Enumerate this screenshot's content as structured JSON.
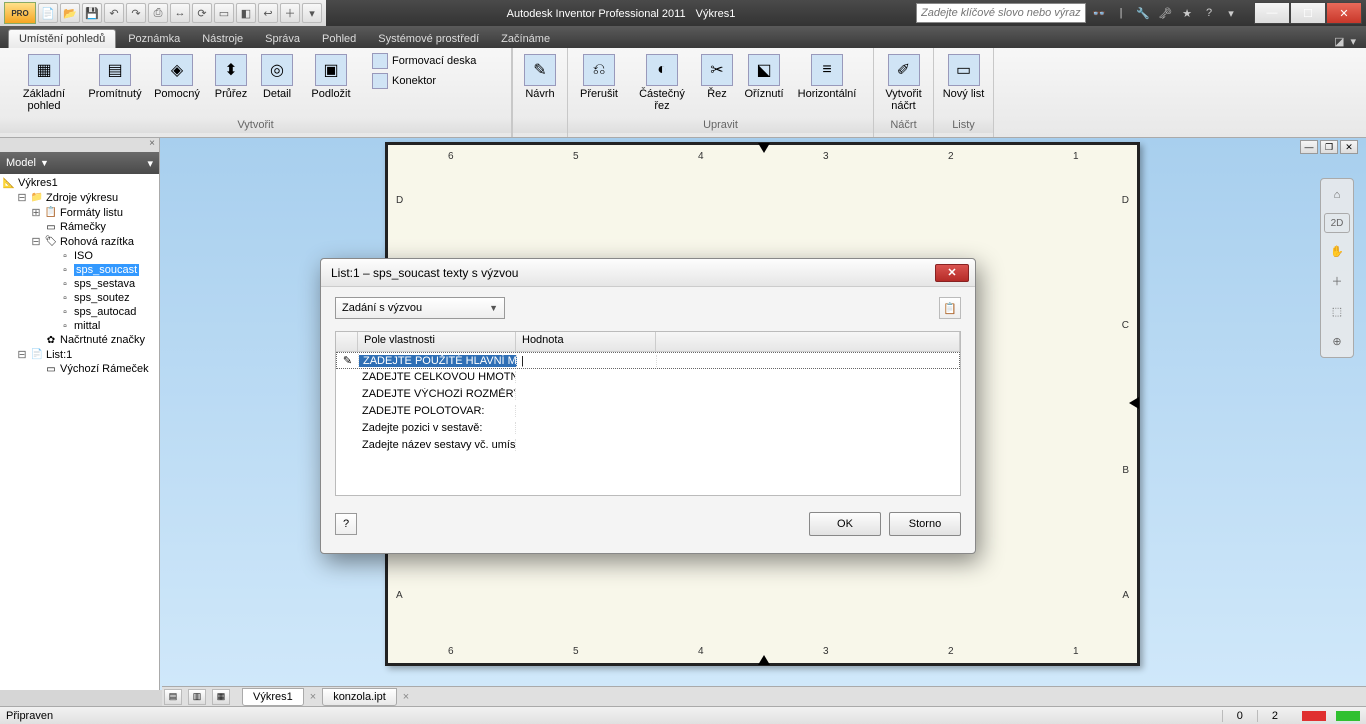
{
  "title_bar": {
    "app_name": "Autodesk Inventor Professional 2011",
    "doc_name": "Výkres1",
    "logo": "PRO",
    "search_placeholder": "Zadejte klíčové slovo nebo výraz."
  },
  "ribbon_tabs": {
    "items": [
      "Umístění pohledů",
      "Poznámka",
      "Nástroje",
      "Správa",
      "Pohled",
      "Systémové prostředí",
      "Začínáme"
    ],
    "active": 0
  },
  "ribbon": {
    "group_create": {
      "label": "Vytvořit",
      "zakladni": "Základní pohled",
      "promitnutý": "Promítnutý",
      "pomocny": "Pomocný",
      "prurez": "Průřez",
      "detail": "Detail",
      "podlozit": "Podložit",
      "formovaci": "Formovací deska",
      "konektor": "Konektor"
    },
    "group_navrh": {
      "navrh": "Návrh"
    },
    "group_upravit": {
      "label": "Upravit",
      "prerusit": "Přerušit",
      "castecny": "Částečný řez",
      "rez": "Řez",
      "oriznuti": "Oříznutí",
      "horizontalni": "Horizontální"
    },
    "group_nacrt": {
      "label": "Náčrt",
      "vytvorit": "Vytvořit náčrt"
    },
    "group_listy": {
      "label": "Listy",
      "novy": "Nový list"
    }
  },
  "browser": {
    "header": "Model",
    "root": "Výkres1",
    "zdroje": "Zdroje výkresu",
    "formaty": "Formáty listu",
    "ramecky": "Rámečky",
    "rohova": "Rohová razítka",
    "iso": "ISO",
    "sps_soucast": "sps_soucast",
    "sps_sestava": "sps_sestava",
    "sps_soutez": "sps_soutez",
    "sps_autocad": "sps_autocad",
    "mittal": "mittal",
    "nacrtnute": "Načrtnuté značky",
    "list1": "List:1",
    "vychozi": "Výchozí Rámeček"
  },
  "dialog": {
    "title": "List:1 – sps_soucast texty s výzvou",
    "combo": "Zadání s výzvou",
    "col_pole": "Pole vlastnosti",
    "col_hodnota": "Hodnota",
    "rows": [
      "ZADEJTE POUŽITÉ HLAVNÍ MĚŘ",
      "ZADEJTE CELKOVOU HMOTNOS",
      "ZADEJTE VÝCHOZÍ ROZMĚRY:",
      "ZADEJTE POLOTOVAR:",
      "Zadejte pozici v sestavě:",
      "Zadejte název sestavy vč. umís"
    ],
    "ok": "OK",
    "storno": "Storno"
  },
  "bottom_tabs": {
    "tab1": "Výkres1",
    "tab2": "konzola.ipt"
  },
  "status": {
    "ready": "Připraven",
    "num1": "0",
    "num2": "2"
  },
  "ruler": {
    "n1": "1",
    "n2": "2",
    "n3": "3",
    "n4": "4",
    "n5": "5",
    "n6": "6",
    "lA": "A",
    "lB": "B",
    "lC": "C",
    "lD": "D"
  }
}
